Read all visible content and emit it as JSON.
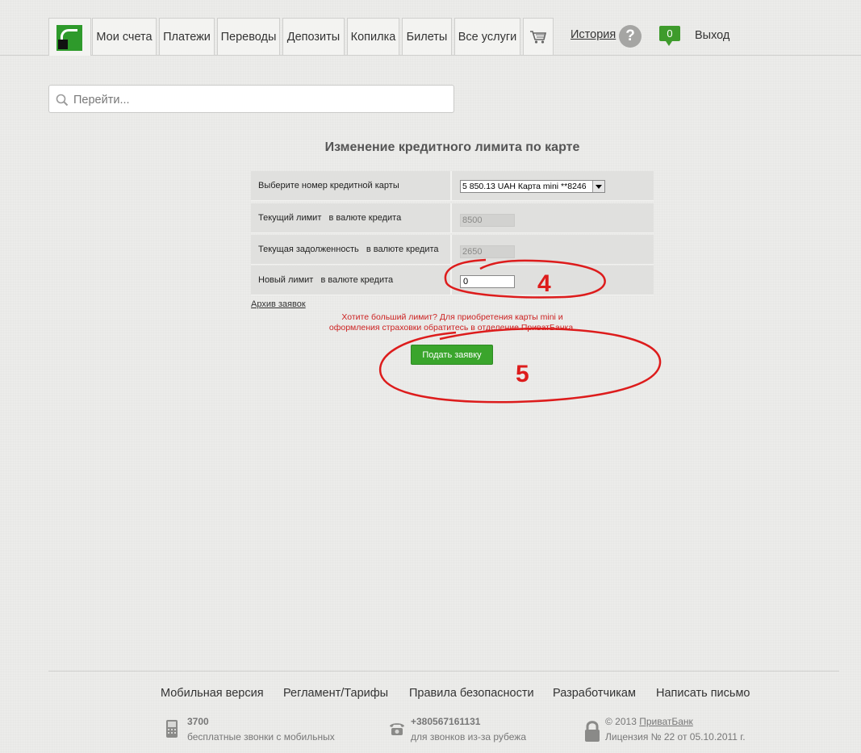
{
  "nav": {
    "tabs": [
      "Мои счета",
      "Платежи",
      "Переводы",
      "Депозиты",
      "Копилка",
      "Билеты",
      "Все услуги"
    ],
    "history": "История",
    "help": "?",
    "messages_count": "0",
    "logout": "Выход"
  },
  "search": {
    "placeholder": "Перейти..."
  },
  "form": {
    "title": "Изменение кредитного лимита по карте",
    "rows": [
      {
        "label": "Выберите номер кредитной карты",
        "value": "5 850.13 UAH  Карта mini **8246"
      },
      {
        "label": "Текущий лимит   в валюте кредита",
        "value": "8500"
      },
      {
        "label": "Текущая задолженность   в валюте кредита",
        "value": "2650"
      },
      {
        "label": "Новый лимит   в валюте кредита",
        "value": "0"
      }
    ],
    "archive_link": "Архив заявок",
    "promo_line1": "Хотите больший лимит? Для приобретения карты mini и",
    "promo_line2": "оформления страховки обратитесь в отделение ПриватБанка.",
    "submit": "Подать заявку"
  },
  "annotations": {
    "mark4": "4",
    "mark5": "5",
    "color": "#dd1c1c"
  },
  "footer": {
    "links": [
      "Мобильная версия",
      "Регламент/Тарифы",
      "Правила безопасности",
      "Разработчикам",
      "Написать письмо"
    ],
    "mobile_number": "3700",
    "mobile_caption": "бесплатные звонки с мобильных",
    "abroad_number": "+380567161131",
    "abroad_caption": "для звонков из-за рубежа",
    "copyright_prefix": "© 2013 ",
    "bank_name": "ПриватБанк",
    "license": "Лицензия № 22 от 05.10.2011 г."
  },
  "colors": {
    "brand_green": "#2e9a2b",
    "button_green": "#3aa52c",
    "promo_red": "#cc2222"
  }
}
